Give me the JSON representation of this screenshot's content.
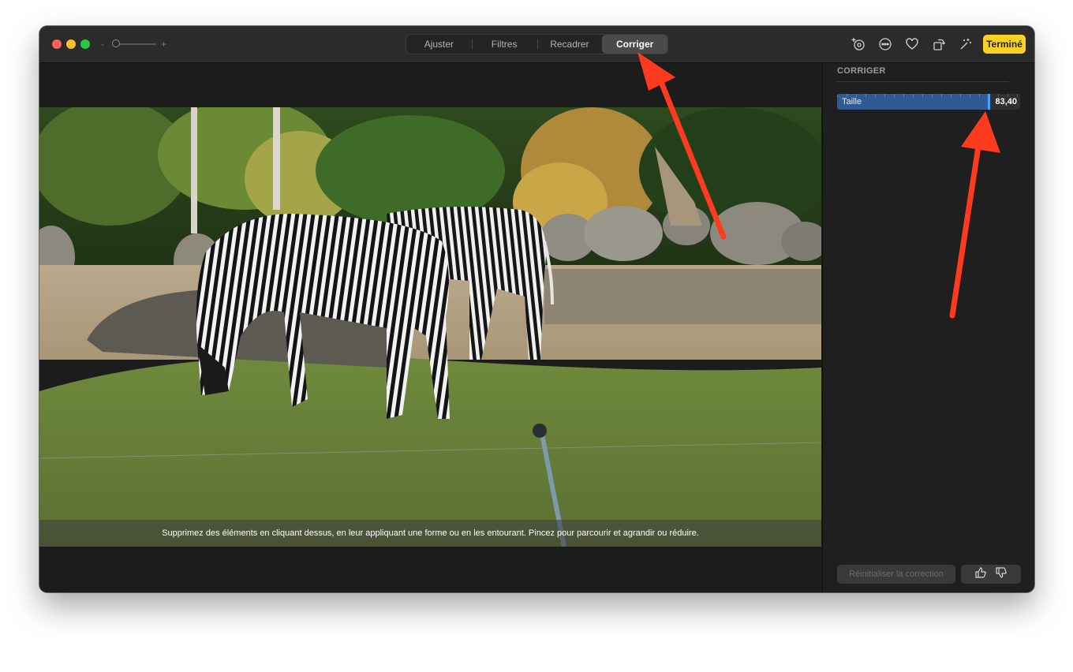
{
  "window": {
    "tabs": [
      {
        "label": "Ajuster",
        "active": false
      },
      {
        "label": "Filtres",
        "active": false
      },
      {
        "label": "Recadrer",
        "active": false
      },
      {
        "label": "Corriger",
        "active": true
      }
    ],
    "zoom": {
      "minus": "-",
      "plus": "+"
    },
    "toolbar_icons": [
      "add-to-album-icon",
      "more-options-icon",
      "favorite-heart-icon",
      "rotate-icon",
      "auto-enhance-icon"
    ],
    "done_label": "Terminé"
  },
  "canvas": {
    "hint": "Supprimez des éléments en cliquant dessus, en leur appliquant une forme ou en les entourant. Pincez pour parcourir et agrandir ou réduire."
  },
  "sidebar": {
    "title": "CORRIGER",
    "size_slider": {
      "label": "Taille",
      "value": "83,40",
      "fraction": 0.834
    },
    "reset_label": "Réinitialiser la correction",
    "feedback_icons": [
      "thumbs-up-icon",
      "thumbs-down-icon"
    ]
  },
  "colors": {
    "accent_yellow": "#f9d125",
    "slider_fill": "#2f5a93",
    "annotation_arrow": "#ff3b1f"
  }
}
